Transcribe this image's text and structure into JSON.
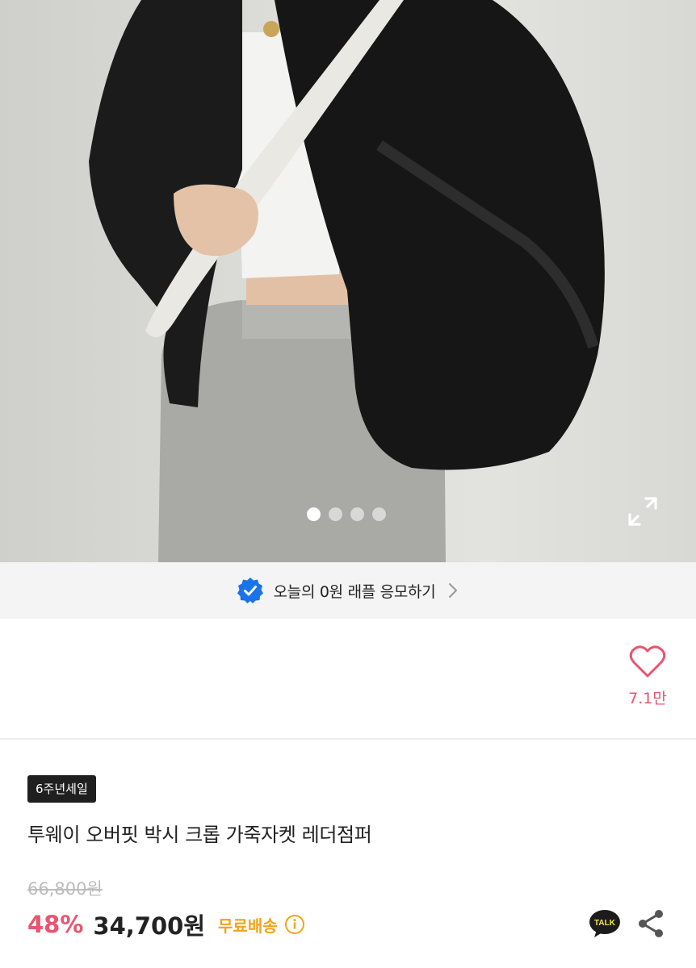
{
  "gallery": {
    "image_count": 4,
    "active_index": 0,
    "expand_icon": "expand-icon"
  },
  "raffle_banner": {
    "icon": "verified-badge-icon",
    "label": "오늘의 0원 래플 응모하기",
    "chevron": "chevron-right-icon"
  },
  "like": {
    "icon": "heart-icon",
    "count": "7.1만"
  },
  "product": {
    "tag": "6주년세일",
    "title": "투웨이 오버핏 박시 크롭 가죽자켓 레더점퍼",
    "original_price": "66,800원",
    "discount": "48%",
    "price": "34,700원",
    "shipping": "무료배송"
  },
  "actions": {
    "kakao_label": "TALK",
    "share_icon": "share-icon",
    "info_icon": "info-icon"
  },
  "colors": {
    "accent_pink": "#e8556f",
    "shipping_orange": "#f2a31b",
    "badge_blue": "#1a73e8"
  }
}
